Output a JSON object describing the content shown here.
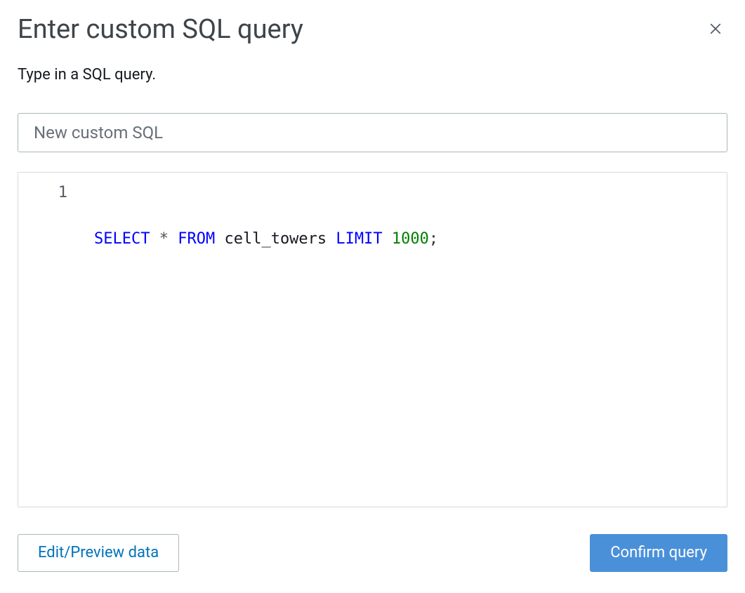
{
  "dialog": {
    "title": "Enter custom SQL query",
    "subtitle": "Type in a SQL query."
  },
  "form": {
    "name_value": "New custom SQL"
  },
  "editor": {
    "line_numbers": [
      "1"
    ],
    "sql": {
      "raw": "SELECT * FROM cell_towers LIMIT 1000;",
      "tokens": [
        {
          "text": "SELECT",
          "type": "kw"
        },
        {
          "text": " ",
          "type": "ws"
        },
        {
          "text": "*",
          "type": "op"
        },
        {
          "text": " ",
          "type": "ws"
        },
        {
          "text": "FROM",
          "type": "kw"
        },
        {
          "text": " ",
          "type": "ws"
        },
        {
          "text": "cell_towers",
          "type": "id"
        },
        {
          "text": " ",
          "type": "ws"
        },
        {
          "text": "LIMIT",
          "type": "kw"
        },
        {
          "text": " ",
          "type": "ws"
        },
        {
          "text": "1000",
          "type": "num"
        },
        {
          "text": ";",
          "type": "punct"
        }
      ]
    }
  },
  "footer": {
    "edit_preview_label": "Edit/Preview data",
    "confirm_label": "Confirm query"
  },
  "icons": {
    "close": "close-icon"
  }
}
